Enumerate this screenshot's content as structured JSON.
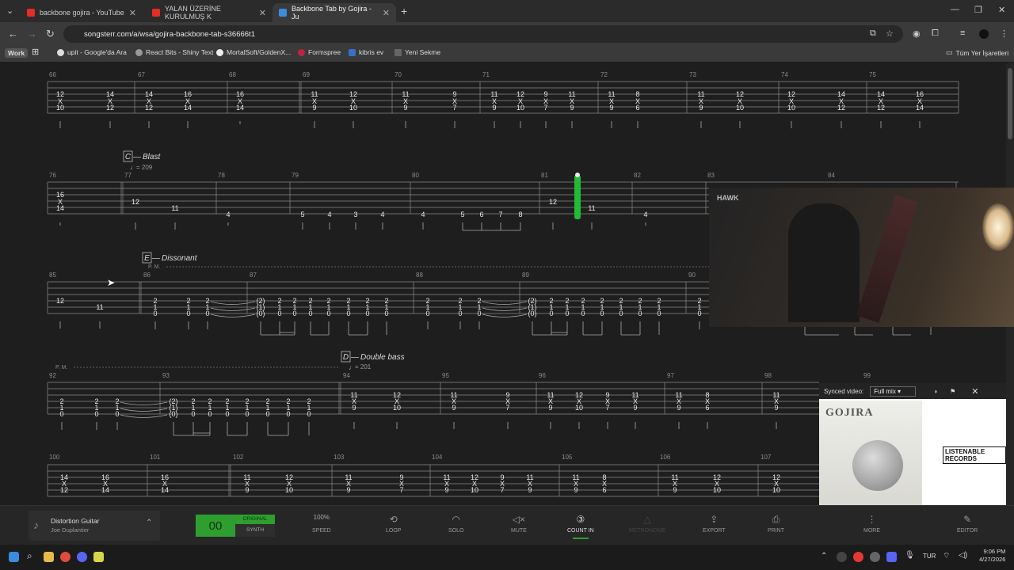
{
  "browser": {
    "tabs": [
      {
        "title": "backbone gojira - YouTube"
      },
      {
        "title": "YALAN ÜZERİNE KURULMUŞ K"
      },
      {
        "title": "Backbone Tab by Gojira - Ju"
      }
    ],
    "url": "songsterr.com/a/wsa/gojira-backbone-tab-s36666t1",
    "bookmarks": [
      "Work",
      "upit - Google'da Ara",
      "React Bits - Shiny Text",
      "MortalSoft/GoldenX...",
      "Formspree",
      "kibris ev",
      "Yeni Sekme",
      "Tüm Yer İşaretleri"
    ]
  },
  "sections": [
    {
      "letter": "C",
      "name": "Blast",
      "tempo": "= 209"
    },
    {
      "letter": "E",
      "name": "Dissonant",
      "tempo": ""
    },
    {
      "letter": "D",
      "name": "Double bass",
      "tempo": "= 201"
    }
  ],
  "palm_mute": "P. M.",
  "rows": [
    {
      "bars": [
        "66",
        "67",
        "68",
        "69",
        "70",
        "71",
        "72",
        "73",
        "74",
        "75"
      ]
    },
    {
      "bars": [
        "76",
        "77",
        "78",
        "79",
        "80",
        "81",
        "82",
        "83",
        "84"
      ]
    },
    {
      "bars": [
        "85",
        "86",
        "87",
        "88",
        "89",
        "90"
      ]
    },
    {
      "bars": [
        "92",
        "93",
        "94",
        "95",
        "96",
        "97",
        "98",
        "99"
      ]
    },
    {
      "bars": [
        "100",
        "101",
        "102",
        "103",
        "104",
        "105",
        "106",
        "107"
      ]
    }
  ],
  "synced_video": {
    "label": "Synced video:",
    "option": "Full mix",
    "album_band": "GOJIRA",
    "label_logo": "LISTENABLE RECORDS",
    "video_logo": "HAWK"
  },
  "player": {
    "instrument": "Distortion Guitar",
    "artist": "Joe Duplantier",
    "counter": "00",
    "original": "ORIGINAL",
    "synth": "SYNTH",
    "speed_value": "100%",
    "speed": "SPEED",
    "loop": "LOOP",
    "solo": "SOLO",
    "mute": "MUTE",
    "count_in": "COUNT IN",
    "metronome": "METRONOME",
    "export": "EXPORT",
    "print": "PRINT",
    "more": "MORE",
    "editor": "EDITOR"
  },
  "taskbar": {
    "lang": "TUR",
    "time": "9:06 PM",
    "date": "4/27/2026"
  },
  "colors": {
    "accent_green": "#2e9e2e",
    "playhead": "#22bb33",
    "youtube_red": "#e52d27",
    "songsterr_blue": "#3a8dde"
  }
}
